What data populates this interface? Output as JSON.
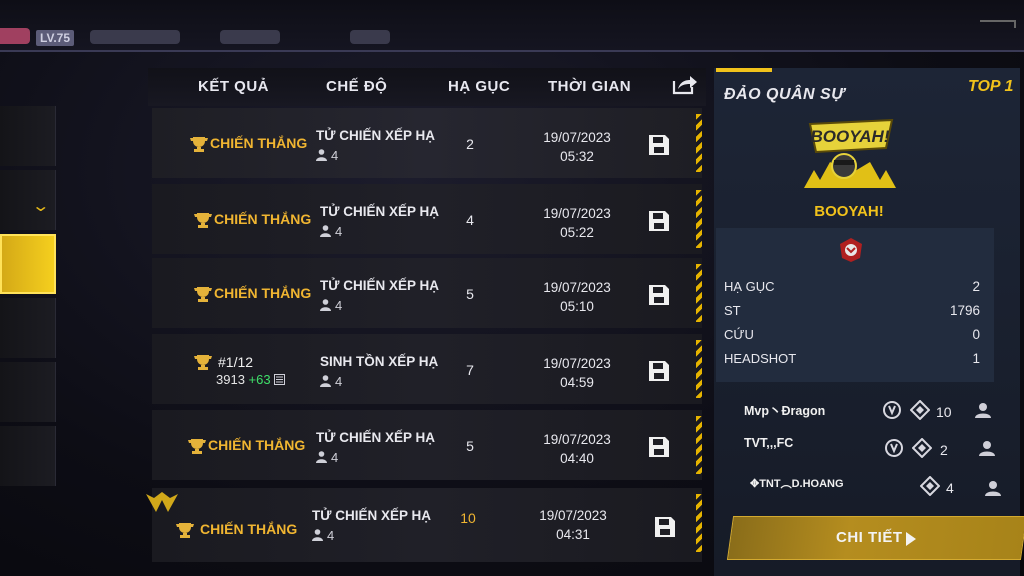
{
  "top_bar": {
    "level": "LV.75"
  },
  "table": {
    "headers": {
      "result": "KẾT QUẢ",
      "mode": "CHẾ ĐỘ",
      "kills": "HẠ GỤC",
      "time": "THỜI GIAN"
    },
    "rows": [
      {
        "result": "CHIẾN THẮNG",
        "mode": "TỬ CHIẾN XẾP HẠ",
        "players": "4",
        "kills": "2",
        "date": "19/07/2023",
        "time": "05:32"
      },
      {
        "result": "CHIẾN THẮNG",
        "mode": "TỬ CHIẾN XẾP HẠ",
        "players": "4",
        "kills": "4",
        "date": "19/07/2023",
        "time": "05:22"
      },
      {
        "result": "CHIẾN THẮNG",
        "mode": "TỬ CHIẾN XẾP HẠ",
        "players": "4",
        "kills": "5",
        "date": "19/07/2023",
        "time": "05:10"
      },
      {
        "rank": "#1/12",
        "rank_points": "3913",
        "rank_gain": "+63",
        "mode": "SINH TỒN XẾP HẠ",
        "players": "4",
        "kills": "7",
        "date": "19/07/2023",
        "time": "04:59"
      },
      {
        "result": "CHIẾN THẮNG",
        "mode": "TỬ CHIẾN XẾP HẠ",
        "players": "4",
        "kills": "5",
        "date": "19/07/2023",
        "time": "04:40"
      },
      {
        "result": "CHIẾN THẮNG",
        "mode": "TỬ CHIẾN XẾP HẠ",
        "players": "4",
        "kills": "10",
        "date": "19/07/2023",
        "time": "04:31"
      }
    ]
  },
  "detail_panel": {
    "map_name": "ĐẢO QUÂN SỰ",
    "placement": "TOP 1",
    "logo_text": "BOOYAH!",
    "result_label": "BOOYAH!",
    "stats": [
      {
        "label": "HẠ GỤC",
        "value": "2"
      },
      {
        "label": "ST",
        "value": "1796"
      },
      {
        "label": "CỨU",
        "value": "0"
      },
      {
        "label": "HEADSHOT",
        "value": "1"
      }
    ],
    "team": [
      {
        "name": "Mvp丶Ðragon",
        "kills": "10"
      },
      {
        "name": "TVT,,,FC",
        "kills": "2"
      },
      {
        "name": "✥TNT︵D.HOANG",
        "kills": "4"
      }
    ],
    "detail_button": "CHI TIẾT"
  },
  "colors": {
    "accent_gold": "#f1c21b",
    "result_gold": "#f0b531",
    "gain_green": "#3fe06a",
    "panel_bg": "#1d2536"
  }
}
